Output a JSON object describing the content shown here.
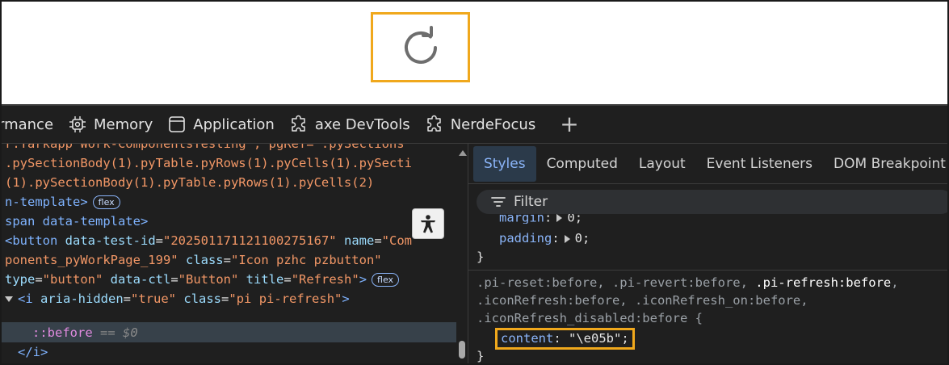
{
  "devtools": {
    "top_tabs": [
      {
        "label": "rmance",
        "icon": "performance-icon"
      },
      {
        "label": "Memory",
        "icon": "memory-chip-icon"
      },
      {
        "label": "Application",
        "icon": "application-window-icon"
      },
      {
        "label": "axe DevTools",
        "icon": "puzzle-extension-icon"
      },
      {
        "label": "NerdeFocus",
        "icon": "puzzle-extension-icon"
      }
    ],
    "add_tab": "+"
  },
  "elements": {
    "line0": {
      "a": "r.Tarkapp Work-ComponentsTesting\", pgRef=\".pySections"
    },
    "line1": {
      "a": ".pySectionBody(1).pyTable.pyRows(1).pyCells(1).pySecti"
    },
    "line2": {
      "a": "(1).pySectionBody(1).pyTable.pyRows(1).pyCells(2)"
    },
    "line3": {
      "a": "n-template>",
      "badge": "flex"
    },
    "line4": {
      "a": "span data-template>"
    },
    "line5": {
      "tag": "<button",
      "attr1": "data-test-id",
      "eq": "=",
      "val1": "\"20250117112110027516​7\"",
      "attr2": "name",
      "val2": "\"Com"
    },
    "line6": {
      "val": "ponents_pyWorkPage_199\"",
      "attr": "class",
      "val2": "\"Icon pzhc pzbutton\""
    },
    "line7": {
      "attr1": "type",
      "val1": "\"button\"",
      "attr2": "data-ctl",
      "val2": "\"Button\"",
      "attr3": "title",
      "val3": "\"Refresh\"",
      "close": ">",
      "badge": "flex"
    },
    "line8": {
      "tag": "<i",
      "attr1": "aria-hidden",
      "val1": "\"true\"",
      "attr2": "class",
      "val2": "\"pi pi-refresh\"",
      "close": ">"
    },
    "line9": {
      "pseudo": "::before",
      "eq": " == $0"
    },
    "line10": {
      "tag": "</i>"
    }
  },
  "styles": {
    "tabs": [
      "Styles",
      "Computed",
      "Layout",
      "Event Listeners",
      "DOM Breakpoint"
    ],
    "filter_label": "Filter",
    "margin_prop": "margin",
    "padding_prop": "padding",
    "zero": "0",
    "close_brace": "}",
    "selector_line1_a": ".pi-reset:before, .pi-revert:before, ",
    "selector_line1_b": ".pi-refresh:before",
    "selector_line1_c": ",",
    "selector_line2": ".iconRefresh:before, .iconRefresh_on:before,",
    "selector_line3": ".iconRefresh_disabled:before {",
    "content_prop": "content",
    "content_val": "\"\\e05b\";"
  },
  "colors": {
    "highlight_box": "#f0a81c",
    "devtools_bg": "#1f1f1f",
    "tag_blue": "#7fb3ff",
    "value_orange": "#f29766"
  }
}
